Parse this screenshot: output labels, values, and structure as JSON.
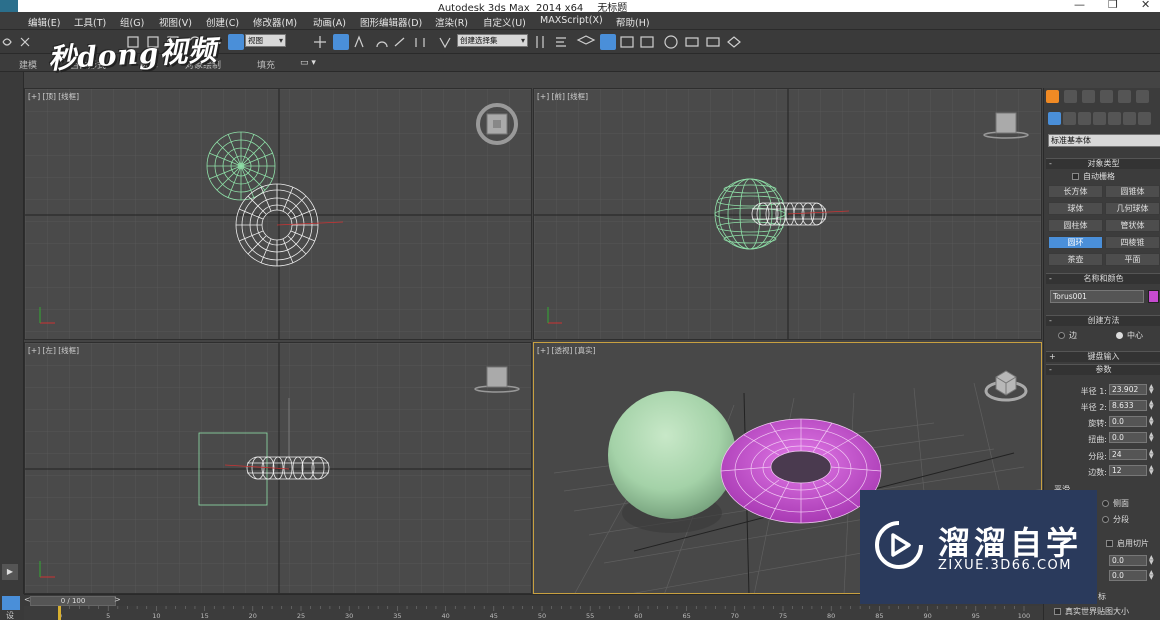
{
  "window": {
    "app_title": "Autodesk 3ds Max  2014 x64",
    "doc_title": "无标题",
    "controls": [
      "—",
      "❐",
      "✕"
    ]
  },
  "menubar": [
    "编辑(E)",
    "工具(T)",
    "组(G)",
    "视图(V)",
    "创建(C)",
    "修改器(M)",
    "动画(A)",
    "图形编辑器(D)",
    "渲染(R)",
    "自定义(U)",
    "MAXScript(X)",
    "帮助(H)"
  ],
  "toolbar": {
    "view_select": "视图",
    "selection_set": "创建选择集"
  },
  "ribbon": {
    "tabs": [
      "建模",
      "自由形式",
      "选择",
      "对象绘制",
      "填充"
    ]
  },
  "watermark_top": "秒dong视频",
  "viewports": [
    {
      "id": "top",
      "label": "[+] [顶] [线框]"
    },
    {
      "id": "front",
      "label": "[+] [前] [线框]"
    },
    {
      "id": "left",
      "label": "[+] [左] [线框]"
    },
    {
      "id": "perspective",
      "label": "[+] [透视] [真实]"
    }
  ],
  "command_panel": {
    "category_dropdown": "标准基本体",
    "object_type": {
      "title": "对象类型",
      "auto_grid": "自动栅格",
      "buttons": [
        "长方体",
        "圆锥体",
        "球体",
        "几何球体",
        "圆柱体",
        "管状体",
        "圆环",
        "四棱锥",
        "茶壶",
        "平面"
      ],
      "selected": "圆环"
    },
    "name_color": {
      "title": "名称和颜色",
      "name": "Torus001",
      "color": "#c64bd0"
    },
    "creation_method": {
      "title": "创建方法",
      "options": [
        "边",
        "中心"
      ],
      "selected": "中心"
    },
    "keyboard_entry": "键盘输入",
    "parameters": {
      "title": "参数",
      "fields": [
        {
          "label": "半径 1:",
          "value": "23.902"
        },
        {
          "label": "半径 2:",
          "value": "8.633"
        },
        {
          "label": "旋转:",
          "value": "0.0"
        },
        {
          "label": "扭曲:",
          "value": "0.0"
        },
        {
          "label": "分段:",
          "value": "24"
        },
        {
          "label": "边数:",
          "value": "12"
        }
      ],
      "smooth_label": "平滑",
      "smooth_options": [
        "侧面",
        "分段"
      ],
      "slice_on": "启用切片",
      "slice_from_value": "0.0",
      "slice_to_value": "0.0",
      "mapping_suffix": "标",
      "real_world": "真实世界贴图大小"
    }
  },
  "timeline": {
    "frame": "0 / 100",
    "ticks": [
      "0",
      "5",
      "10",
      "15",
      "20",
      "25",
      "30",
      "35",
      "40",
      "45",
      "50",
      "55",
      "60",
      "65",
      "70",
      "75",
      "80",
      "85",
      "90",
      "95",
      "100"
    ]
  },
  "bottom_left": {
    "set_key": "设"
  },
  "brand": {
    "name": "溜溜自学",
    "url": "ZIXUE.3D66.COM"
  }
}
